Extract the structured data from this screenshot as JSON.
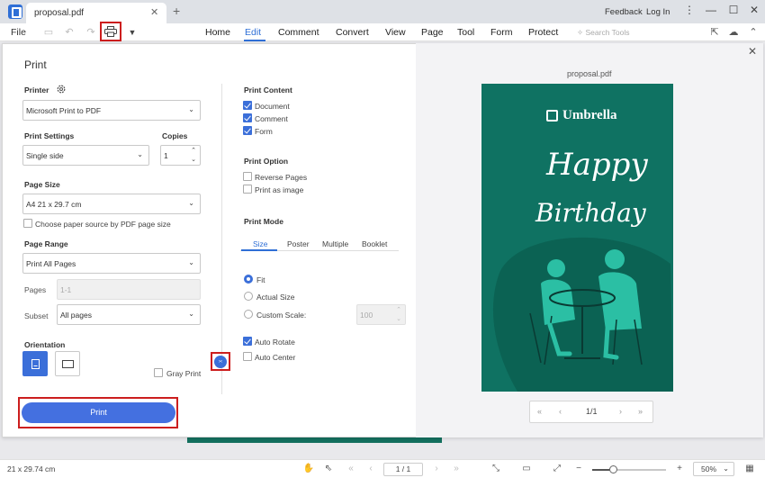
{
  "titlebar": {
    "tab_title": "proposal.pdf",
    "tab_close": "✕",
    "tab_add": "+",
    "feedback": "Feedback",
    "login": "Log In",
    "win_more": "⋮",
    "win_min": "—",
    "win_max": "☐",
    "win_close": "✕"
  },
  "menubar": {
    "file": "File",
    "items": [
      "Home",
      "Edit",
      "Comment",
      "Convert",
      "View",
      "Page",
      "Tool",
      "Form",
      "Protect"
    ],
    "active_index": 1,
    "search_placeholder": "Search Tools",
    "accent": "#2f6fd6"
  },
  "dialog": {
    "title": "Print",
    "printer": {
      "label": "Printer",
      "value": "Microsoft Print to PDF"
    },
    "print_settings": {
      "label": "Print Settings",
      "value": "Single side"
    },
    "copies": {
      "label": "Copies",
      "value": "1"
    },
    "page_size": {
      "label": "Page Size",
      "value": "A4 21 x 29.7 cm"
    },
    "paper_source": {
      "label": "Choose paper source by PDF page size",
      "checked": false
    },
    "page_range": {
      "label": "Page Range",
      "value": "Print All Pages"
    },
    "pages": {
      "label": "Pages",
      "value": "1-1"
    },
    "subset": {
      "label": "Subset",
      "value": "All pages"
    },
    "orientation": {
      "label": "Orientation",
      "selected": "portrait"
    },
    "gray_print": {
      "label": "Gray Print",
      "checked": false
    },
    "print_content": {
      "label": "Print Content",
      "items": [
        {
          "label": "Document",
          "checked": true
        },
        {
          "label": "Comment",
          "checked": true
        },
        {
          "label": "Form",
          "checked": true
        }
      ]
    },
    "print_option": {
      "label": "Print Option",
      "items": [
        {
          "label": "Reverse Pages",
          "checked": false
        },
        {
          "label": "Print as image",
          "checked": false
        }
      ]
    },
    "print_mode": {
      "label": "Print Mode",
      "tabs": [
        "Size",
        "Poster",
        "Multiple",
        "Booklet"
      ],
      "active_tab": 0,
      "fit": "Fit",
      "actual_size": "Actual Size",
      "custom_scale": "Custom Scale:",
      "scale_value": "100",
      "selected": "fit"
    },
    "auto_rotate": {
      "label": "Auto Rotate",
      "checked": true
    },
    "auto_center": {
      "label": "Auto Center",
      "checked": false
    },
    "print_button": "Print",
    "collapse_icon": "›‹",
    "close_icon": "✕",
    "accent": "#3b6fd9",
    "highlight": "#cc1e1e"
  },
  "preview": {
    "file_name": "proposal.pdf",
    "brand": "Umbrella",
    "headline_1": "Happy",
    "headline_2": "Birthday",
    "card_color": "#0f7262",
    "pager": {
      "first": "«",
      "prev": "‹",
      "page": "1/1",
      "next": "›",
      "last": "»"
    }
  },
  "statusbar": {
    "page_size": "21 x 29.74 cm",
    "page_indicator": "1 / 1",
    "zoom": "50%",
    "zoom_level_percent": 28
  }
}
